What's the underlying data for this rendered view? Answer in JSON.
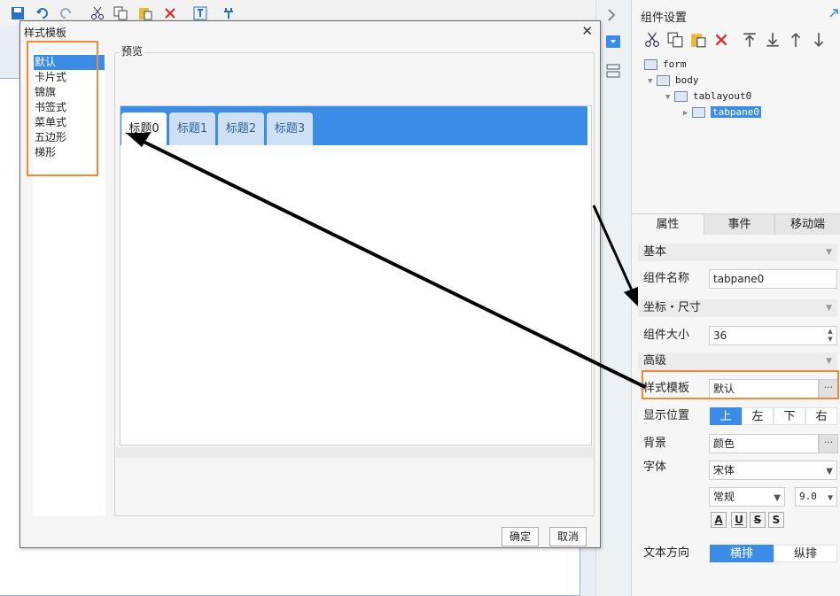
{
  "right_panel": {
    "title": "组件设置",
    "tree": [
      {
        "label": "form"
      },
      {
        "label": "body"
      },
      {
        "label": "tablayout0"
      },
      {
        "label": "tabpane0",
        "selected": true
      }
    ],
    "tabs": [
      "属性",
      "事件",
      "移动端"
    ],
    "sections": {
      "basic": "基本",
      "coords": "坐标・尺寸",
      "advanced": "高级"
    },
    "name_label": "组件名称",
    "name_value": "tabpane0",
    "size_label": "组件大小",
    "size_value": "36",
    "style_label": "样式模板",
    "style_value": "默认",
    "position_label": "显示位置",
    "positions": [
      "上",
      "左",
      "下",
      "右"
    ],
    "position_selected": "上",
    "bg_label": "背景",
    "bg_value": "颜色",
    "font_label": "字体",
    "font_family": "宋体",
    "font_style": "常规",
    "font_size": "9.0",
    "font_buttons": [
      "A",
      "U",
      "S",
      "S"
    ],
    "text_dir_label": "文本方向",
    "text_dirs": [
      "横排",
      "纵排"
    ],
    "text_dir_selected": "横排"
  },
  "dialog": {
    "title": "样式模板",
    "close": "✕",
    "styles": [
      "默认",
      "卡片式",
      "锦旗",
      "书签式",
      "菜单式",
      "五边形",
      "梯形"
    ],
    "selected_style": "默认",
    "preview_label": "预览",
    "preview_tabs": [
      "标题0",
      "标题1",
      "标题2",
      "标题3"
    ],
    "ok": "确定",
    "cancel": "取消"
  },
  "colors": {
    "accent": "#3b8ce6",
    "highlight": "#f08a36"
  }
}
